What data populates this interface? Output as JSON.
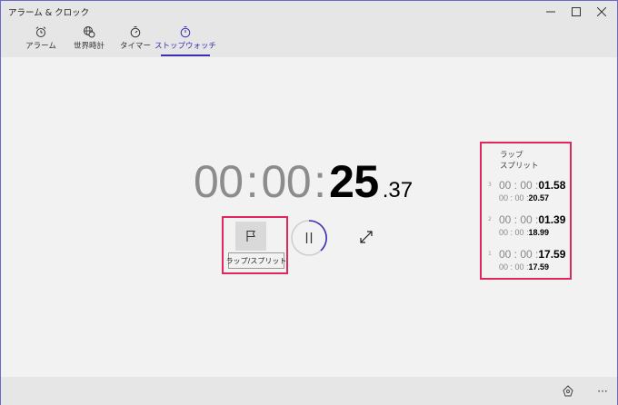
{
  "window": {
    "title": "アラーム & クロック"
  },
  "tabs": [
    {
      "label": "アラーム",
      "icon": "alarm-clock-icon",
      "active": false
    },
    {
      "label": "世界時計",
      "icon": "world-clock-icon",
      "active": false
    },
    {
      "label": "タイマー",
      "icon": "timer-icon",
      "active": false
    },
    {
      "label": "ストップウォッチ",
      "icon": "stopwatch-icon",
      "active": true
    }
  ],
  "stopwatch": {
    "hours": "00",
    "minutes": "00",
    "separator": ":",
    "seconds": "25",
    "centiseconds": ".37"
  },
  "controls": {
    "lap_tooltip": "ラップ/スプリット"
  },
  "laps_panel": {
    "header_lap": "ラップ",
    "header_split": "スプリット",
    "laps": [
      {
        "number": "3",
        "lap_prefix": "00 : 00 :",
        "lap_value": "01.58",
        "split_prefix": "00 : 00 :",
        "split_value": "20.57"
      },
      {
        "number": "2",
        "lap_prefix": "00 : 00 :",
        "lap_value": "01.39",
        "split_prefix": "00 : 00 :",
        "split_value": "18.99"
      },
      {
        "number": "1",
        "lap_prefix": "00 : 00 :",
        "lap_value": "17.59",
        "split_prefix": "00 : 00 :",
        "split_value": "17.59"
      }
    ]
  },
  "bottombar": {
    "more_label": "···"
  },
  "colors": {
    "accent": "#3b2fb5",
    "highlight": "#e0265c"
  }
}
